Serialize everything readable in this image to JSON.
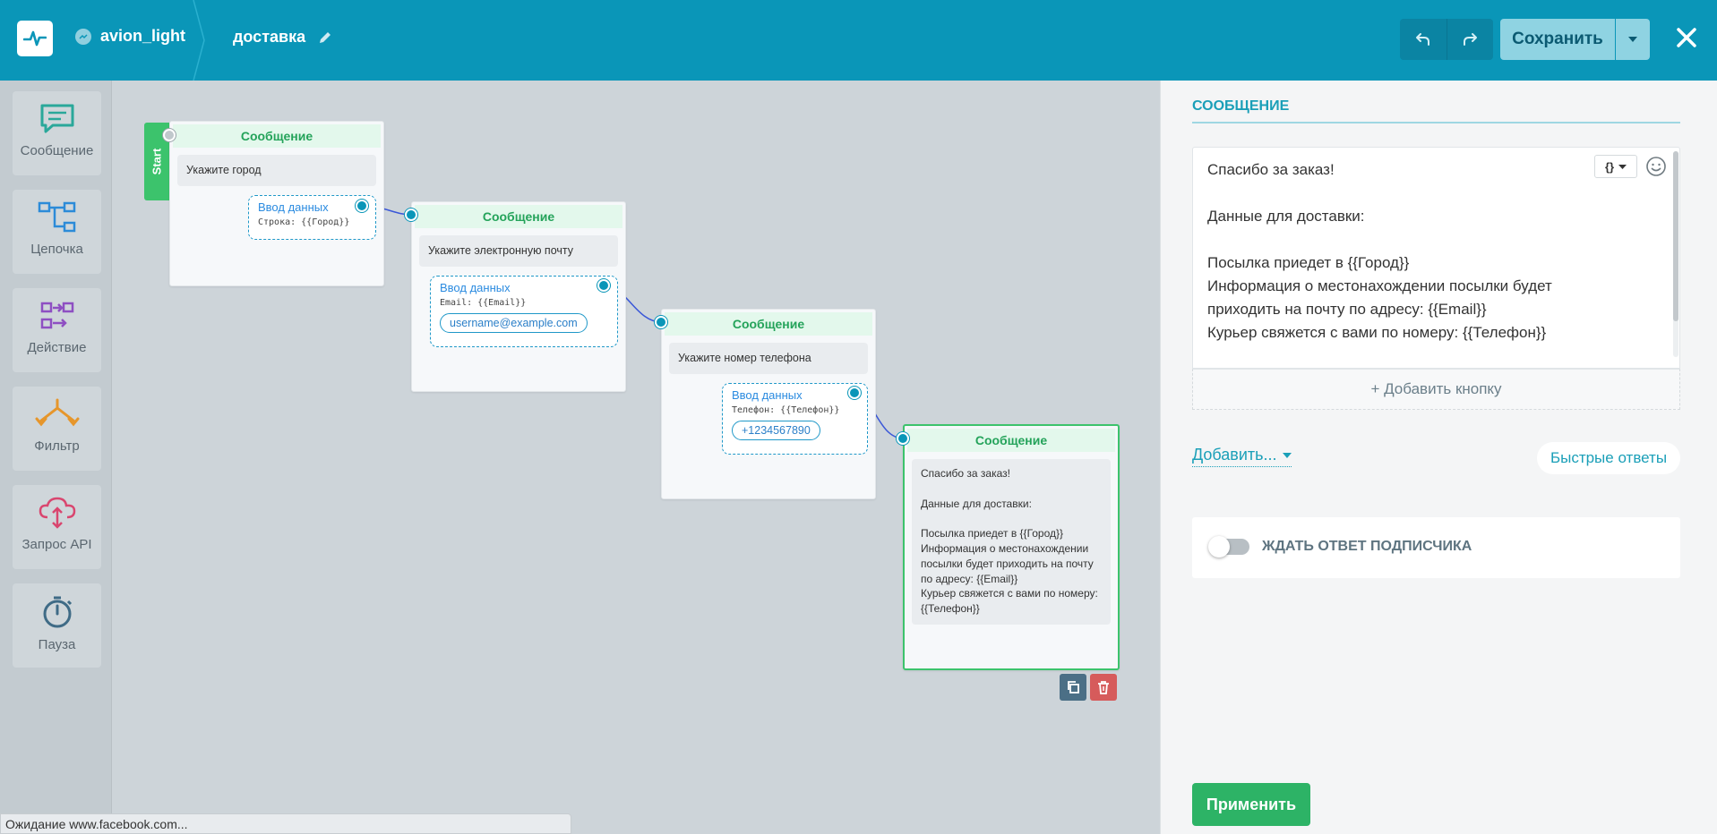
{
  "header": {
    "bot_name": "avion_light",
    "flow_name": "доставка",
    "save_label": "Сохранить"
  },
  "sidebar": {
    "items": [
      {
        "label": "Сообщение",
        "icon": "message-icon"
      },
      {
        "label": "Цепочка",
        "icon": "chain-icon"
      },
      {
        "label": "Действие",
        "icon": "action-icon"
      },
      {
        "label": "Фильтр",
        "icon": "filter-icon"
      },
      {
        "label": "Запрос API",
        "icon": "api-request-icon"
      },
      {
        "label": "Пауза",
        "icon": "timer-icon"
      }
    ]
  },
  "canvas": {
    "start_label": "Start",
    "nodes": [
      {
        "title": "Сообщение",
        "text": "Укажите город",
        "input_title": "Ввод данных",
        "input_var": "Строка: {{Город}}"
      },
      {
        "title": "Сообщение",
        "text": "Укажите электронную почту",
        "input_title": "Ввод данных",
        "input_var": "Email: {{Email}}",
        "chip": "username@example.com"
      },
      {
        "title": "Сообщение",
        "text": "Укажите номер телефона",
        "input_title": "Ввод данных",
        "input_var": "Телефон: {{Телефон}}",
        "chip": "+1234567890"
      },
      {
        "title": "Сообщение",
        "text": "Спасибо за заказ!\n\nДанные для доставки:\n\nПосылка приедет в {{Город}}\nИнформация о местонахождении посылки будет приходить на почту по адресу: {{Email}}\nКурьер свяжется с вами по номеру: {{Телефон}}"
      }
    ]
  },
  "status_bar": "Ожидание www.facebook.com...",
  "panel": {
    "title": "СООБЩЕНИЕ",
    "message": "Спасибо за заказ!\n\nДанные для доставки:\n\nПосылка приедет в {{Город}}\nИнформация о местонахождении посылки будет приходить на почту по адресу: {{Email}}\nКурьер свяжется с вами по номеру: {{Телефон}}",
    "var_button": "{}",
    "add_button": "+ Добавить кнопку",
    "add_more": "Добавить...",
    "quick_replies": "Быстрые ответы",
    "wait_label": "ЖДАТЬ ОТВЕТ ПОДПИСЧИКА",
    "apply": "Применить"
  },
  "colors": {
    "header": "#0a96b8",
    "accent_green": "#2db366",
    "node_header_text": "#24a35a",
    "link_blue": "#1a9fb8"
  }
}
